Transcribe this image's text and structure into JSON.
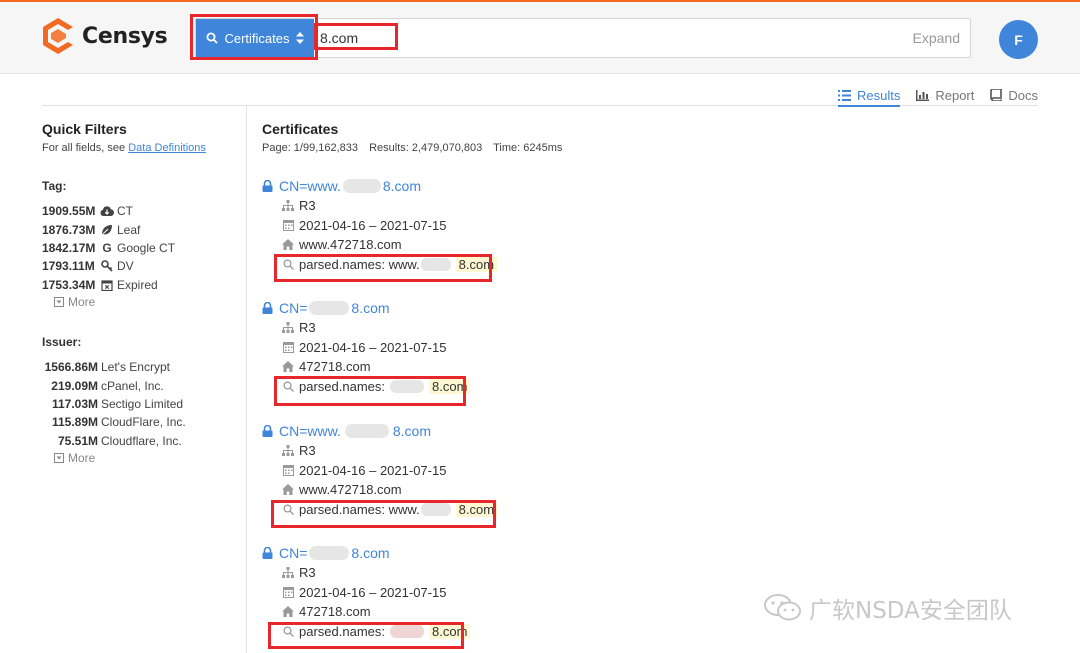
{
  "colors": {
    "accent": "#3f85d9",
    "brand_orange": "#f26a21",
    "annotation_red": "#e8272c",
    "match_highlight": "#fdf7d2"
  },
  "header": {
    "logo_text": "Censys",
    "search_type": "Certificates",
    "search_value": "8.com",
    "expand_label": "Expand",
    "avatar_initial": "F"
  },
  "tabs": [
    {
      "label": "Results",
      "icon": "list-icon",
      "active": true
    },
    {
      "label": "Report",
      "icon": "bar-chart-icon",
      "active": false
    },
    {
      "label": "Docs",
      "icon": "book-icon",
      "active": false
    }
  ],
  "sidebar": {
    "title": "Quick Filters",
    "subtitle_prefix": "For all fields, see",
    "subtitle_link": "Data Definitions",
    "tag": {
      "heading": "Tag:",
      "items": [
        {
          "count": "1909.55M",
          "label": "CT",
          "icon": "cloud-icon"
        },
        {
          "count": "1876.73M",
          "label": "Leaf",
          "icon": "leaf-icon"
        },
        {
          "count": "1842.17M",
          "label": "Google CT",
          "icon": "google-icon"
        },
        {
          "count": "1793.11M",
          "label": "DV",
          "icon": "key-icon"
        },
        {
          "count": "1753.34M",
          "label": "Expired",
          "icon": "calendar-x-icon"
        }
      ],
      "more_label": "More"
    },
    "issuer": {
      "heading": "Issuer:",
      "items": [
        {
          "count": "1566.86M",
          "label": "Let's Encrypt"
        },
        {
          "count": "219.09M",
          "label": "cPanel, Inc."
        },
        {
          "count": "117.03M",
          "label": "Sectigo Limited"
        },
        {
          "count": "115.89M",
          "label": "CloudFlare, Inc."
        },
        {
          "count": "75.51M",
          "label": "Cloudflare, Inc."
        }
      ],
      "more_label": "More"
    }
  },
  "main": {
    "title": "Certificates",
    "page": "Page: 1/99,162,833",
    "results": "Results: 2,479,070,803",
    "time": "Time: 6245ms",
    "results_list": [
      {
        "title": "CN=www.",
        "title_tail": "8.com",
        "issuer": "R3",
        "validity": "2021-04-16 – 2021-07-15",
        "host": "www.472718.com",
        "match_prefix": "parsed.names: www.",
        "match_tail": "8.com"
      },
      {
        "title": "CN=",
        "title_tail": "8.com",
        "issuer": "R3",
        "validity": "2021-04-16 – 2021-07-15",
        "host": "472718.com",
        "match_prefix": "parsed.names: ",
        "match_tail": "8.com"
      },
      {
        "title": "CN=www.",
        "title_tail": "8.com",
        "issuer": "R3",
        "validity": "2021-04-16 – 2021-07-15",
        "host": "www.472718.com",
        "match_prefix": "parsed.names: www.",
        "match_tail": "8.com"
      },
      {
        "title": "CN=",
        "title_tail": "8.com",
        "issuer": "R3",
        "validity": "2021-04-16 – 2021-07-15",
        "host": "472718.com",
        "match_prefix": "parsed.names:",
        "match_tail": "8.com"
      }
    ]
  },
  "watermark": "广软NSDA安全团队"
}
